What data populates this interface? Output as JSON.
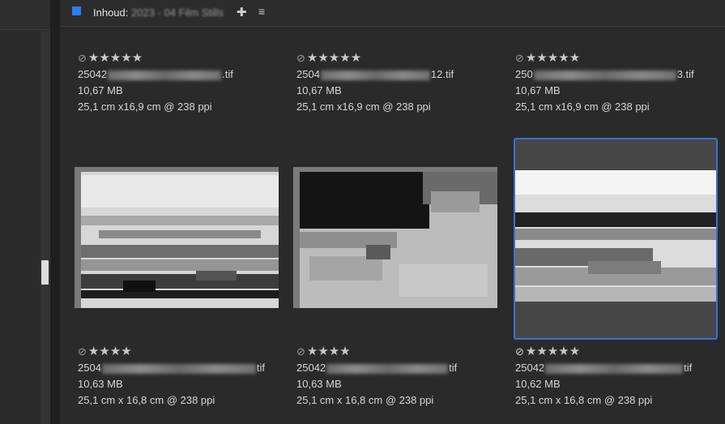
{
  "header": {
    "title": "Inhoud:",
    "path": "2023 - 04 Film Stills",
    "plus_icon": "plus-icon",
    "menu_icon": "menu-icon",
    "accent": "#2d7cf2"
  },
  "items": [
    {
      "rating": "★★★★★",
      "name_start": "25042",
      "name_end": ".tif",
      "size": "10,67 MB",
      "dims": "25,1 cm x16,9 cm @ 238 ppi",
      "selected": false
    },
    {
      "rating": "★★★★★",
      "name_start": "2504",
      "name_end": "12.tif",
      "size": "10,67 MB",
      "dims": "25,1 cm x16,9 cm @ 238 ppi",
      "selected": false
    },
    {
      "rating": "★★★★★",
      "name_start": "250",
      "name_end": "3.tif",
      "size": "10,67 MB",
      "dims": "25,1 cm x16,9 cm @ 238 ppi",
      "selected": false
    },
    {
      "rating": "★★★★",
      "name_start": "2504",
      "name_end": "tif",
      "size": "10,63 MB",
      "dims": "25,1 cm x 16,8 cm @ 238 ppi",
      "selected": false
    },
    {
      "rating": "★★★★",
      "name_start": "25042",
      "name_end": "tif",
      "size": "10,63 MB",
      "dims": "25,1 cm x 16,8 cm @ 238 ppi",
      "selected": false
    },
    {
      "rating": "★★★★★",
      "name_start": "25042",
      "name_end": "tif",
      "size": "10,62 MB",
      "dims": "25,1 cm x 16,8 cm @ 238 ppi",
      "selected": true
    }
  ]
}
